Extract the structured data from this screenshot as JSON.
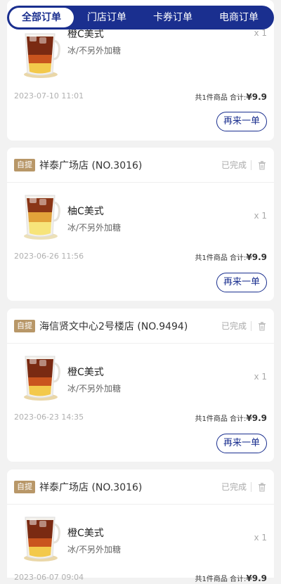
{
  "tabs": [
    {
      "label": "全部订单",
      "active": true
    },
    {
      "label": "门店订单",
      "active": false
    },
    {
      "label": "卡券订单",
      "active": false
    },
    {
      "label": "电商订单",
      "active": false
    }
  ],
  "orders": [
    {
      "badge": "",
      "store": "",
      "status": "",
      "item": {
        "name": "橙C美式",
        "spec": "冰/不另外加糖",
        "qty": "x 1"
      },
      "date": "2023-07-10 11:01",
      "total_prefix": "共1件商品 合计:",
      "price": "¥9.9",
      "reorder_label": "再来一单"
    },
    {
      "badge": "自提",
      "store": "祥泰广场店 (NO.3016)",
      "status": "已完成",
      "item": {
        "name": "柚C美式",
        "spec": "冰/不另外加糖",
        "qty": "x 1"
      },
      "date": "2023-06-26 11:56",
      "total_prefix": "共1件商品 合计:",
      "price": "¥9.9",
      "reorder_label": "再来一单"
    },
    {
      "badge": "自提",
      "store": "海信贤文中心2号楼店 (NO.9494)",
      "status": "已完成",
      "item": {
        "name": "橙C美式",
        "spec": "冰/不另外加糖",
        "qty": "x 1"
      },
      "date": "2023-06-23 14:35",
      "total_prefix": "共1件商品 合计:",
      "price": "¥9.9",
      "reorder_label": "再来一单"
    },
    {
      "badge": "自提",
      "store": "祥泰广场店 (NO.3016)",
      "status": "已完成",
      "item": {
        "name": "橙C美式",
        "spec": "冰/不另外加糖",
        "qty": "x 1"
      },
      "date": "2023-06-07 09:04",
      "total_prefix": "共1件商品 合计:",
      "price": "¥9.9",
      "reorder_label": ""
    }
  ]
}
